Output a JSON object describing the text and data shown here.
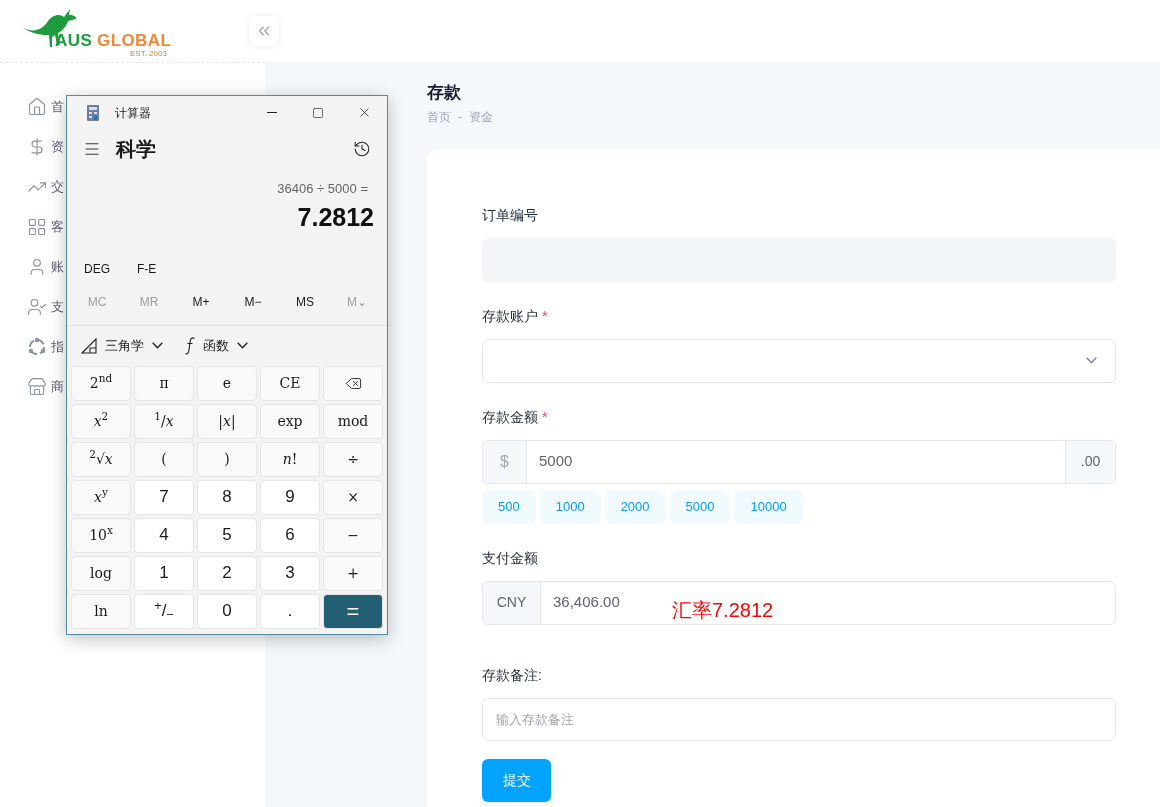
{
  "logo": {
    "brand_primary": "AUS",
    "brand_secondary": "GLOBAL",
    "tagline": "EST. 2003"
  },
  "sidebar": {
    "items": [
      {
        "label": "首",
        "kind": "home"
      },
      {
        "label": "资",
        "kind": "dollar"
      },
      {
        "label": "交",
        "kind": "chart"
      },
      {
        "label": "客",
        "kind": "grid"
      },
      {
        "label": "账",
        "kind": "user"
      },
      {
        "label": "支",
        "kind": "user-check"
      },
      {
        "label": "指",
        "kind": "ring"
      },
      {
        "label": "商",
        "kind": "store"
      }
    ]
  },
  "page": {
    "title": "存款",
    "breadcrumb": [
      "首页",
      "资金"
    ],
    "breadcrumb_separator": "-"
  },
  "form": {
    "fields": [
      {
        "kind": "readonly",
        "label": "订单编号",
        "required": false
      },
      {
        "kind": "select",
        "label": "存款账户",
        "required": true
      },
      {
        "kind": "amount",
        "label": "存款金额",
        "required": true,
        "prefix": "$",
        "value": "5000",
        "suffix": ".00",
        "presets": [
          "500",
          "1000",
          "2000",
          "5000",
          "10000"
        ]
      },
      {
        "kind": "prefixed",
        "label": "支付金额",
        "required": false,
        "prefix": "CNY",
        "value": "36,406.00",
        "annotation": "汇率7.2812"
      },
      {
        "kind": "text",
        "label": "存款备注:",
        "required": false,
        "placeholder": "输入存款备注"
      }
    ],
    "submit": "提交",
    "required_mark": "*"
  },
  "calculator": {
    "title": "计算器",
    "mode": "科学",
    "expression": "36406 ÷ 5000 =",
    "result": "7.2812",
    "toggles": [
      "DEG",
      "F-E"
    ],
    "memory": [
      {
        "label": "MC",
        "disabled": true
      },
      {
        "label": "MR",
        "disabled": true
      },
      {
        "label": "M+",
        "disabled": false
      },
      {
        "label": "M−",
        "disabled": false
      },
      {
        "label": "MS",
        "disabled": false
      },
      {
        "label": "M⌄",
        "disabled": true
      }
    ],
    "dropdowns": [
      {
        "label": "三角学",
        "kind": "triangle"
      },
      {
        "label": "函数",
        "kind": "function"
      }
    ],
    "keys": [
      {
        "label": "2$^{nd}$",
        "kind": "fn"
      },
      {
        "label": "π",
        "kind": "fn"
      },
      {
        "label": "e",
        "kind": "fn"
      },
      {
        "label": "CE",
        "kind": "fn"
      },
      {
        "kind": "backspace"
      },
      {
        "label": "*x*$^{2}$",
        "kind": "fn"
      },
      {
        "label": "$^{1}$/*x*",
        "kind": "fn"
      },
      {
        "label": "|*x*|",
        "kind": "fn"
      },
      {
        "label": "exp",
        "kind": "fn"
      },
      {
        "label": "mod",
        "kind": "fn"
      },
      {
        "label": "$^{2}$√*x*",
        "kind": "fn"
      },
      {
        "label": "(",
        "kind": "fn"
      },
      {
        "label": ")",
        "kind": "fn"
      },
      {
        "label": "*n*!",
        "kind": "fn"
      },
      {
        "label": "÷",
        "kind": "fn"
      },
      {
        "label": "*x*$^{y}$",
        "kind": "fn"
      },
      {
        "label": "7",
        "kind": "num"
      },
      {
        "label": "8",
        "kind": "num"
      },
      {
        "label": "9",
        "kind": "num"
      },
      {
        "label": "×",
        "kind": "fn"
      },
      {
        "label": "10$^{x}$",
        "kind": "fn"
      },
      {
        "label": "4",
        "kind": "num"
      },
      {
        "label": "5",
        "kind": "num"
      },
      {
        "label": "6",
        "kind": "num"
      },
      {
        "label": "−",
        "kind": "fn"
      },
      {
        "label": "log",
        "kind": "fn"
      },
      {
        "label": "1",
        "kind": "num"
      },
      {
        "label": "2",
        "kind": "num"
      },
      {
        "label": "3",
        "kind": "num"
      },
      {
        "label": "+",
        "kind": "fn"
      },
      {
        "label": "ln",
        "kind": "fn"
      },
      {
        "label": "$^{+}$/$_{−}$",
        "kind": "num"
      },
      {
        "label": "0",
        "kind": "num"
      },
      {
        "label": ".",
        "kind": "num"
      },
      {
        "label": "=",
        "kind": "equals"
      }
    ]
  }
}
